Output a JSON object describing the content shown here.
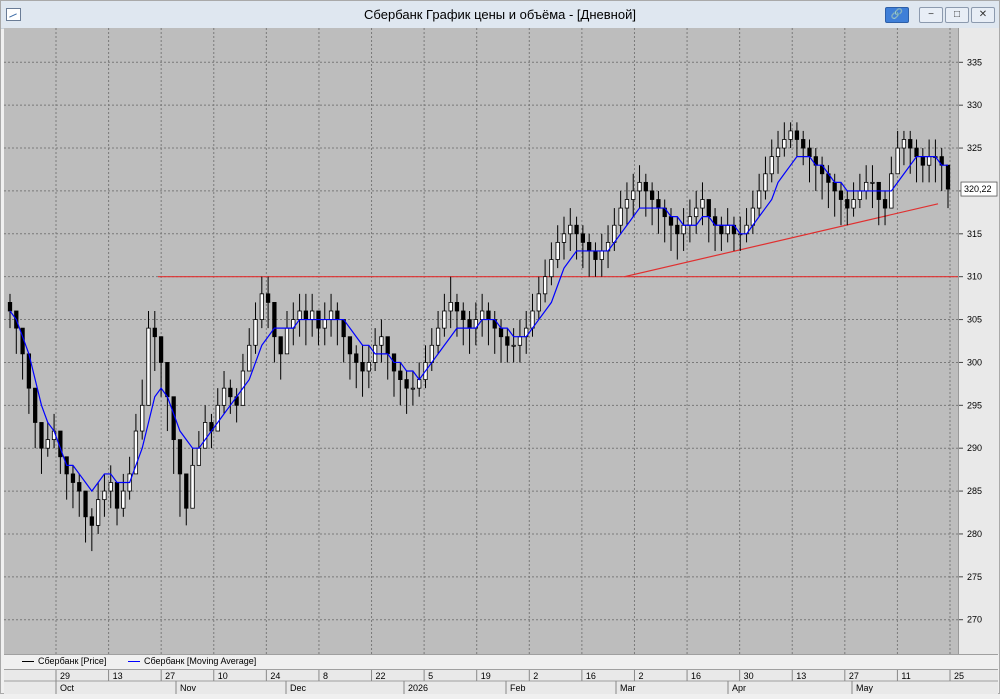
{
  "window": {
    "title": "Сбербанк График цены и объёма - [Дневной]",
    "buttons": [
      "pin",
      "minimize",
      "maximize",
      "close"
    ]
  },
  "chart_data": {
    "type": "candlestick",
    "title": "",
    "ylim": [
      266,
      339
    ],
    "yticks": [
      270,
      275,
      280,
      285,
      290,
      295,
      300,
      305,
      310,
      315,
      320,
      325,
      330,
      335
    ],
    "grid": true,
    "legend_position": "bottom-left",
    "last_price_label": "320,22",
    "x_day_labels": [
      "29",
      "13",
      "27",
      "10",
      "24",
      "8",
      "22",
      "5",
      "19",
      "2",
      "16",
      "2",
      "16",
      "30",
      "13",
      "27",
      "11",
      "25"
    ],
    "x_month_labels": [
      "Oct",
      "Nov",
      "Dec",
      "2026",
      "Feb",
      "Mar",
      "Apr",
      "May"
    ],
    "horizontal_level": {
      "value": 310,
      "color": "#e03030"
    },
    "trendline": {
      "start": {
        "date": "Mar 2",
        "value": 310
      },
      "end": {
        "date": "May 25",
        "value": 318.5
      },
      "color": "#e03030"
    },
    "series": [
      {
        "name": "Сбербанк [Price]",
        "color": "#000000",
        "close": [
          306,
          304,
          301,
          297,
          293,
          290,
          291,
          292,
          289,
          287,
          286,
          285,
          282,
          281,
          284,
          285,
          286,
          283,
          285,
          287,
          292,
          295,
          304,
          303,
          300,
          296,
          291,
          287,
          283,
          288,
          290,
          293,
          292,
          295,
          297,
          296,
          295,
          299,
          302,
          305,
          308,
          307,
          303,
          301,
          304,
          305,
          306,
          305,
          306,
          304,
          305,
          306,
          305,
          303,
          301,
          300,
          299,
          300,
          302,
          303,
          301,
          299,
          298,
          297,
          297,
          298,
          300,
          302,
          304,
          306,
          307,
          306,
          305,
          304,
          305,
          306,
          305,
          304,
          303,
          302,
          302,
          303,
          304,
          306,
          308,
          310,
          312,
          314,
          315,
          316,
          315,
          314,
          313,
          312,
          313,
          314,
          316,
          318,
          319,
          320,
          321,
          320,
          319,
          318,
          317,
          316,
          315,
          316,
          317,
          318,
          319,
          317,
          316,
          315,
          316,
          315,
          315,
          316,
          318,
          320,
          322,
          324,
          325,
          326,
          327,
          326,
          325,
          324,
          323,
          322,
          321,
          320,
          319,
          318,
          319,
          320,
          321,
          321,
          319,
          318,
          322,
          325,
          326,
          325,
          324,
          323,
          324,
          324,
          323,
          320.22
        ],
        "high": [
          308,
          306,
          303,
          299,
          296,
          293,
          293,
          294,
          291,
          289,
          288,
          287,
          284,
          283,
          286,
          287,
          288,
          285,
          287,
          289,
          294,
          298,
          306,
          306,
          303,
          299,
          294,
          290,
          286,
          290,
          292,
          295,
          294,
          297,
          299,
          298,
          297,
          301,
          304,
          307,
          310,
          310,
          305,
          303,
          306,
          307,
          308,
          308,
          308,
          306,
          307,
          308,
          307,
          305,
          303,
          302,
          302,
          302,
          304,
          305,
          303,
          301,
          300,
          299,
          299,
          300,
          302,
          304,
          306,
          308,
          310,
          308,
          307,
          306,
          307,
          308,
          307,
          306,
          305,
          304,
          304,
          305,
          306,
          308,
          310,
          312,
          314,
          316,
          317,
          318,
          317,
          316,
          315,
          314,
          315,
          316,
          318,
          320,
          321,
          322,
          323,
          322,
          321,
          320,
          319,
          318,
          317,
          318,
          319,
          320,
          321,
          319,
          318,
          317,
          318,
          317,
          317,
          318,
          320,
          322,
          324,
          326,
          327,
          328,
          328,
          328,
          327,
          326,
          325,
          324,
          323,
          322,
          321,
          320,
          321,
          322,
          323,
          323,
          321,
          320,
          324,
          327,
          327,
          327,
          326,
          325,
          326,
          326,
          325,
          323
        ],
        "low": [
          304,
          301,
          298,
          294,
          290,
          287,
          289,
          290,
          287,
          284,
          283,
          282,
          279,
          278,
          280,
          282,
          283,
          281,
          282,
          284,
          287,
          291,
          298,
          299,
          296,
          292,
          287,
          282,
          281,
          285,
          288,
          290,
          290,
          292,
          294,
          294,
          293,
          296,
          299,
          301,
          304,
          304,
          300,
          298,
          301,
          302,
          303,
          302,
          303,
          302,
          302,
          303,
          302,
          300,
          298,
          297,
          296,
          297,
          299,
          300,
          298,
          296,
          295,
          294,
          295,
          296,
          297,
          299,
          301,
          303,
          304,
          303,
          302,
          301,
          302,
          303,
          302,
          301,
          300,
          300,
          300,
          300,
          301,
          303,
          305,
          307,
          309,
          311,
          312,
          313,
          312,
          311,
          310,
          310,
          310,
          311,
          313,
          315,
          316,
          317,
          318,
          317,
          316,
          315,
          314,
          313,
          312,
          313,
          314,
          315,
          316,
          314,
          313,
          313,
          314,
          313,
          313,
          314,
          315,
          317,
          319,
          321,
          322,
          324,
          325,
          324,
          323,
          321,
          320,
          319,
          318,
          317,
          316,
          316,
          317,
          318,
          319,
          318,
          316,
          316,
          319,
          322,
          323,
          322,
          321,
          321,
          321,
          321,
          320,
          318
        ]
      },
      {
        "name": "Сбербанк [Moving Average]",
        "color": "#0000ff",
        "values": [
          306,
          305,
          303,
          301,
          298,
          295,
          293,
          292,
          290,
          288,
          288,
          287,
          286,
          285,
          286,
          287,
          287,
          286,
          286,
          286,
          288,
          290,
          293,
          296,
          297,
          296,
          294,
          292,
          291,
          290,
          290,
          291,
          292,
          293,
          294,
          295,
          296,
          297,
          298,
          300,
          302,
          303,
          304,
          304,
          304,
          304,
          305,
          305,
          305,
          305,
          305,
          305,
          305,
          305,
          304,
          303,
          302,
          302,
          301,
          301,
          301,
          300,
          300,
          299,
          299,
          298,
          299,
          300,
          301,
          302,
          303,
          304,
          304,
          304,
          304,
          305,
          305,
          305,
          304,
          304,
          303,
          303,
          303,
          304,
          305,
          306,
          307,
          309,
          311,
          312,
          313,
          313,
          313,
          313,
          313,
          313,
          314,
          315,
          316,
          317,
          318,
          318,
          318,
          318,
          318,
          317,
          317,
          316,
          316,
          316,
          317,
          317,
          316,
          316,
          316,
          316,
          315,
          315,
          316,
          317,
          318,
          319,
          321,
          322,
          323,
          324,
          324,
          324,
          323,
          323,
          322,
          321,
          321,
          320,
          320,
          320,
          320,
          320,
          320,
          320,
          320,
          321,
          322,
          323,
          324,
          324,
          324,
          324,
          323,
          323
        ]
      }
    ]
  }
}
